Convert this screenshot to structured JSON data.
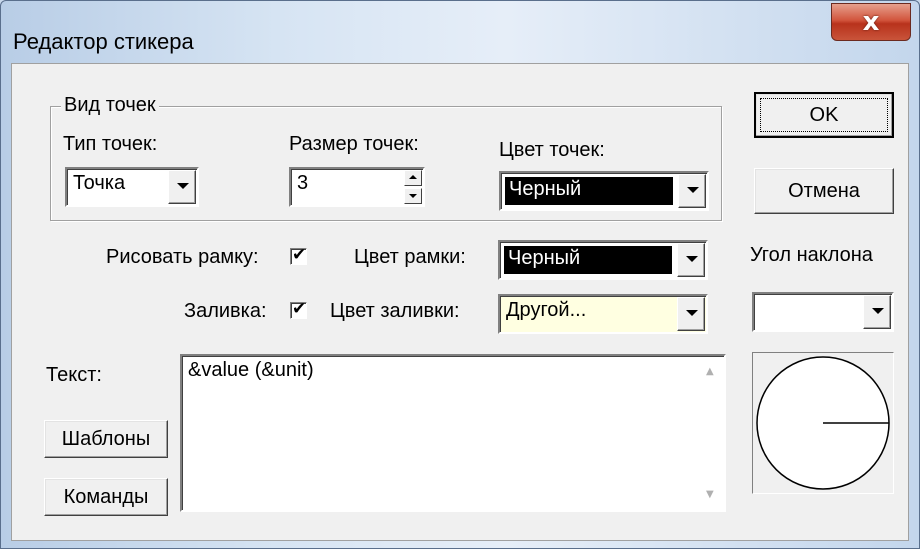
{
  "window": {
    "title": "Редактор стикера",
    "close_glyph": "x"
  },
  "dot_group": {
    "legend": "Вид точек",
    "type_label": "Тип точек:",
    "type_value": "Точка",
    "size_label": "Размер точек:",
    "size_value": "3",
    "color_label": "Цвет точек:",
    "color_value": "Черный"
  },
  "frame": {
    "draw_label": "Рисовать рамку:",
    "draw_checked": true,
    "color_label": "Цвет рамки:",
    "color_value": "Черный"
  },
  "fill": {
    "label": "Заливка:",
    "checked": true,
    "color_label": "Цвет заливки:",
    "color_value": "Другой..."
  },
  "text": {
    "label": "Текст:",
    "value": "&value  (&unit)",
    "templates_button": "Шаблоны",
    "commands_button": "Команды"
  },
  "buttons": {
    "ok": "OK",
    "cancel": "Отмена"
  },
  "angle": {
    "label": "Угол наклона",
    "value": ""
  },
  "colors": {
    "black_swatch": "#000000",
    "fill_swatch": "#ffffe1",
    "close_button": "#c9543a"
  }
}
